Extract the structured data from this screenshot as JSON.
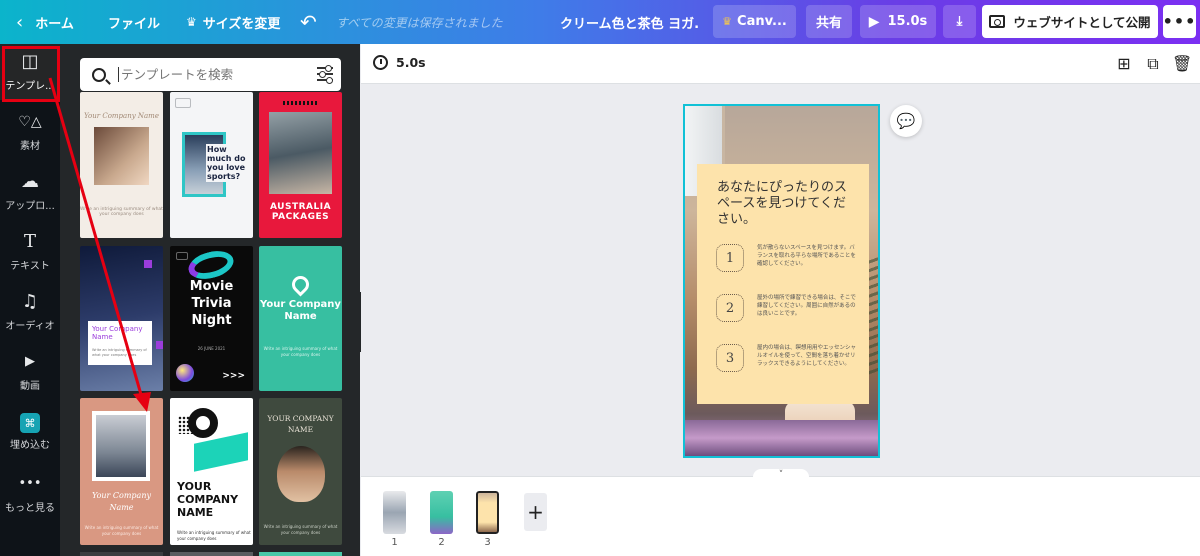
{
  "topbar": {
    "home": "ホーム",
    "file": "ファイル",
    "resize": "サイズを変更",
    "saved_status": "すべての変更は保存されました",
    "doc_title": "クリーム色と茶色 ヨガ...",
    "canva_pro": "Canv...",
    "share": "共有",
    "duration": "15.0s",
    "publish": "ウェブサイトとして公開",
    "more": "•••"
  },
  "rail": {
    "items": [
      {
        "label": "テンプレ...",
        "icon": "▥"
      },
      {
        "label": "素材",
        "icon": "♡△"
      },
      {
        "label": "アップロ...",
        "icon": "☁"
      },
      {
        "label": "テキスト",
        "icon": "T"
      },
      {
        "label": "オーディオ",
        "icon": "♫"
      },
      {
        "label": "動画",
        "icon": "▶"
      },
      {
        "label": "埋め込む",
        "icon": "⌘"
      },
      {
        "label": "もっと見る",
        "icon": "•••"
      }
    ]
  },
  "panel": {
    "search_placeholder": "テンプレートを検索",
    "templates": {
      "t1_script": "Your Company Name",
      "t1_small": "Write an intriguing summary of what your company does",
      "t2_question": "How much do you love sports?",
      "t3_title": "AUSTRALIA PACKAGES",
      "t4_name": "Your Company Name",
      "t4_small": "Write an intriguing summary of what your company does",
      "t5_title": "Movie Trivia Night",
      "t5_date": "26 JUNE 2021",
      "t5_arrows": ">>>",
      "t6_title": "Your Company Name",
      "t6_small": "Write an intriguing summary of what your company does",
      "t7_script": "Your Company Name",
      "t7_small": "Write an intriguing summary of what your company does",
      "t8_title": "YOUR COMPANY NAME",
      "t8_small": "Write an intriguing summary of what your company does",
      "t9_title": "YOUR COMPANY NAME",
      "t9_small": "Write an intriguing summary of what your company does"
    }
  },
  "editor": {
    "page_duration": "5.0s",
    "card_title": "あなたにぴったりのスペースを見つけてください。",
    "steps": [
      {
        "num": "1",
        "text": "気が散らないスペースを見つけます。バランスを取れる平らな場所であることを確認してください。"
      },
      {
        "num": "2",
        "text": "屋外の場所で練習できる場合は、そこで練習してください。周囲に自然があるのは良いことです。"
      },
      {
        "num": "3",
        "text": "屋内の場合は、瞑想用用やエッセンシャルオイルを使って、空間を落ち着かせリラックスできるようにしてください。"
      }
    ]
  },
  "pages": [
    {
      "num": "1"
    },
    {
      "num": "2"
    },
    {
      "num": "3"
    }
  ],
  "colors": {
    "annotation_red": "#e60012",
    "selection_cyan": "#11c1d6",
    "card_cream": "#fde3ab"
  }
}
